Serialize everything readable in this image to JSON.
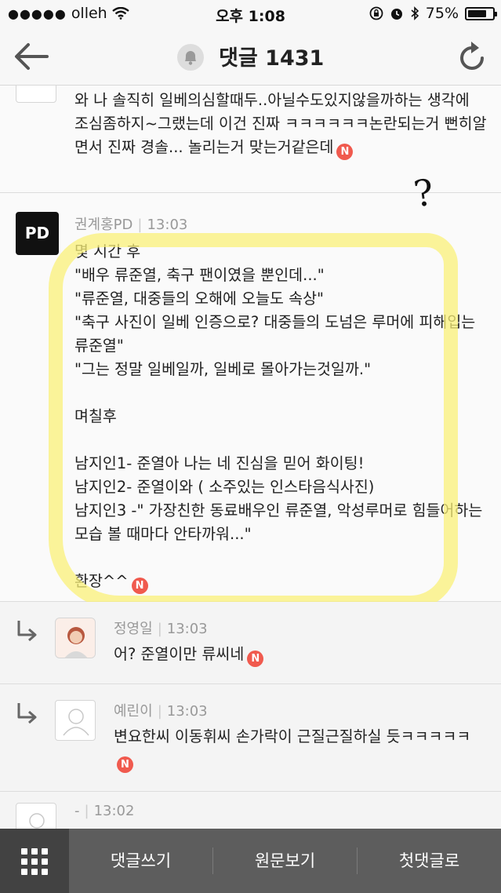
{
  "status_bar": {
    "carrier": "olleh",
    "time": "오후 1:08",
    "battery": "75%",
    "battery_level": 0.75
  },
  "header": {
    "title": "댓글 1431"
  },
  "comments": [
    {
      "text": "와 나 솔직히 일베의심할때두..아닐수도있지않을까하는 생각에 조심좀하지~그랬는데 이건 진짜 ㅋㅋㅋㅋㅋㅋ논란되는거 뻔히알면서 진짜 경솔... 놀리는거 맞는거같은데",
      "badge": "N"
    },
    {
      "avatar_text": "PD",
      "author": "권계홍PD",
      "time": "13:03",
      "text": "몇 시간 후\n\"배우 류준열, 축구 팬이였을 뿐인데...\"\n\"류준열, 대중들의 오해에 오늘도 속상\"\n\"축구 사진이 일베 인증으로? 대중들의 도넘은 루머에 피해입는 류준열\"\n\"그는 정말 일베일까, 일베로 몰아가는것일까.\"\n\n며칠후\n\n남지인1- 준열아 나는 네 진심을 믿어 화이팅!\n남지인2- 준열이와 ( 소주있는 인스타음식사진)\n남지인3 -\" 가장친한 동료배우인 류준열, 악성루머로 힘들어하는 모습 볼 때마다 안타까워...\"\n\n환장^^",
      "badge": "N"
    },
    {
      "author": "정영일",
      "time": "13:03",
      "text": "어? 준열이만 류씨네",
      "badge": "N"
    },
    {
      "author": "예린이",
      "time": "13:03",
      "text": "변요한씨 이동휘씨 손가락이 근질근질하실 듯ㅋㅋㅋㅋㅋ",
      "badge": "N"
    },
    {
      "author": "-",
      "time": "13:02"
    }
  ],
  "bottom_bar": {
    "tabs": [
      "댓글쓰기",
      "원문보기",
      "첫댓글로"
    ]
  },
  "colors": {
    "badge": "#f05a4e",
    "highlight": "#faf078",
    "bottom_bar": "#5d5d5d"
  },
  "icons": [
    "signal-dots-icon",
    "wifi-icon",
    "lock-rotation-icon",
    "alarm-icon",
    "bluetooth-icon",
    "battery-icon",
    "back-arrow-icon",
    "bell-icon",
    "refresh-icon",
    "reply-arrow-icon",
    "grid-menu-icon"
  ]
}
